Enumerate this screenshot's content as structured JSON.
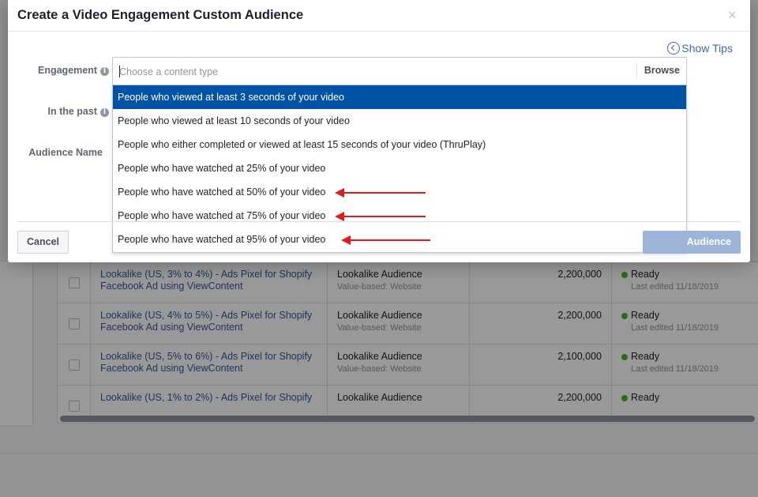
{
  "modal": {
    "title": "Create a Video Engagement Custom Audience",
    "close_label": "×",
    "show_tips_label": "Show Tips",
    "engagement_label": "Engagement",
    "in_the_past_label": "In the past",
    "audience_name_label": "Audience Name",
    "info_glyph": "i",
    "content_type": {
      "placeholder": "Choose a content type",
      "value": "",
      "browse_label": "Browse"
    },
    "options": [
      {
        "label": "People who viewed at least 3 seconds of your video",
        "selected": true
      },
      {
        "label": "People who viewed at least 10 seconds of your video",
        "selected": false
      },
      {
        "label": "People who either completed or viewed at least 15 seconds of your video (ThruPlay)",
        "selected": false
      },
      {
        "label": "People who have watched at 25% of your video",
        "selected": false
      },
      {
        "label": "People who have watched at 50% of your video",
        "selected": false
      },
      {
        "label": "People who have watched at 75% of your video",
        "selected": false
      },
      {
        "label": "People who have watched at 95% of your video",
        "selected": false
      }
    ],
    "cancel_label": "Cancel",
    "create_label": "Audience",
    "colors": {
      "selected_option_bg": "#0052a5",
      "arrow": "#e41a1a",
      "link": "#365899"
    }
  },
  "background_table": {
    "rows": [
      {
        "name": "Lookalike (US, 3% to 4%) - Ads Pixel for Shopify Facebook Ad using ViewContent",
        "type": "Lookalike Audience",
        "subtype": "Value-based: Website",
        "size": "2,200,000",
        "status": "Ready",
        "edited": "Last edited 11/18/2019"
      },
      {
        "name": "Lookalike (US, 4% to 5%) - Ads Pixel for Shopify Facebook Ad using ViewContent",
        "type": "Lookalike Audience",
        "subtype": "Value-based: Website",
        "size": "2,200,000",
        "status": "Ready",
        "edited": "Last edited 11/18/2019"
      },
      {
        "name": "Lookalike (US, 5% to 6%) - Ads Pixel for Shopify Facebook Ad using ViewContent",
        "type": "Lookalike Audience",
        "subtype": "Value-based: Website",
        "size": "2,100,000",
        "status": "Ready",
        "edited": "Last edited 11/18/2019"
      },
      {
        "name": "Lookalike (US, 1% to 2%) - Ads Pixel for Shopify",
        "type": "Lookalike Audience",
        "subtype": "",
        "size": "2,200,000",
        "status": "Ready",
        "edited": ""
      }
    ]
  }
}
